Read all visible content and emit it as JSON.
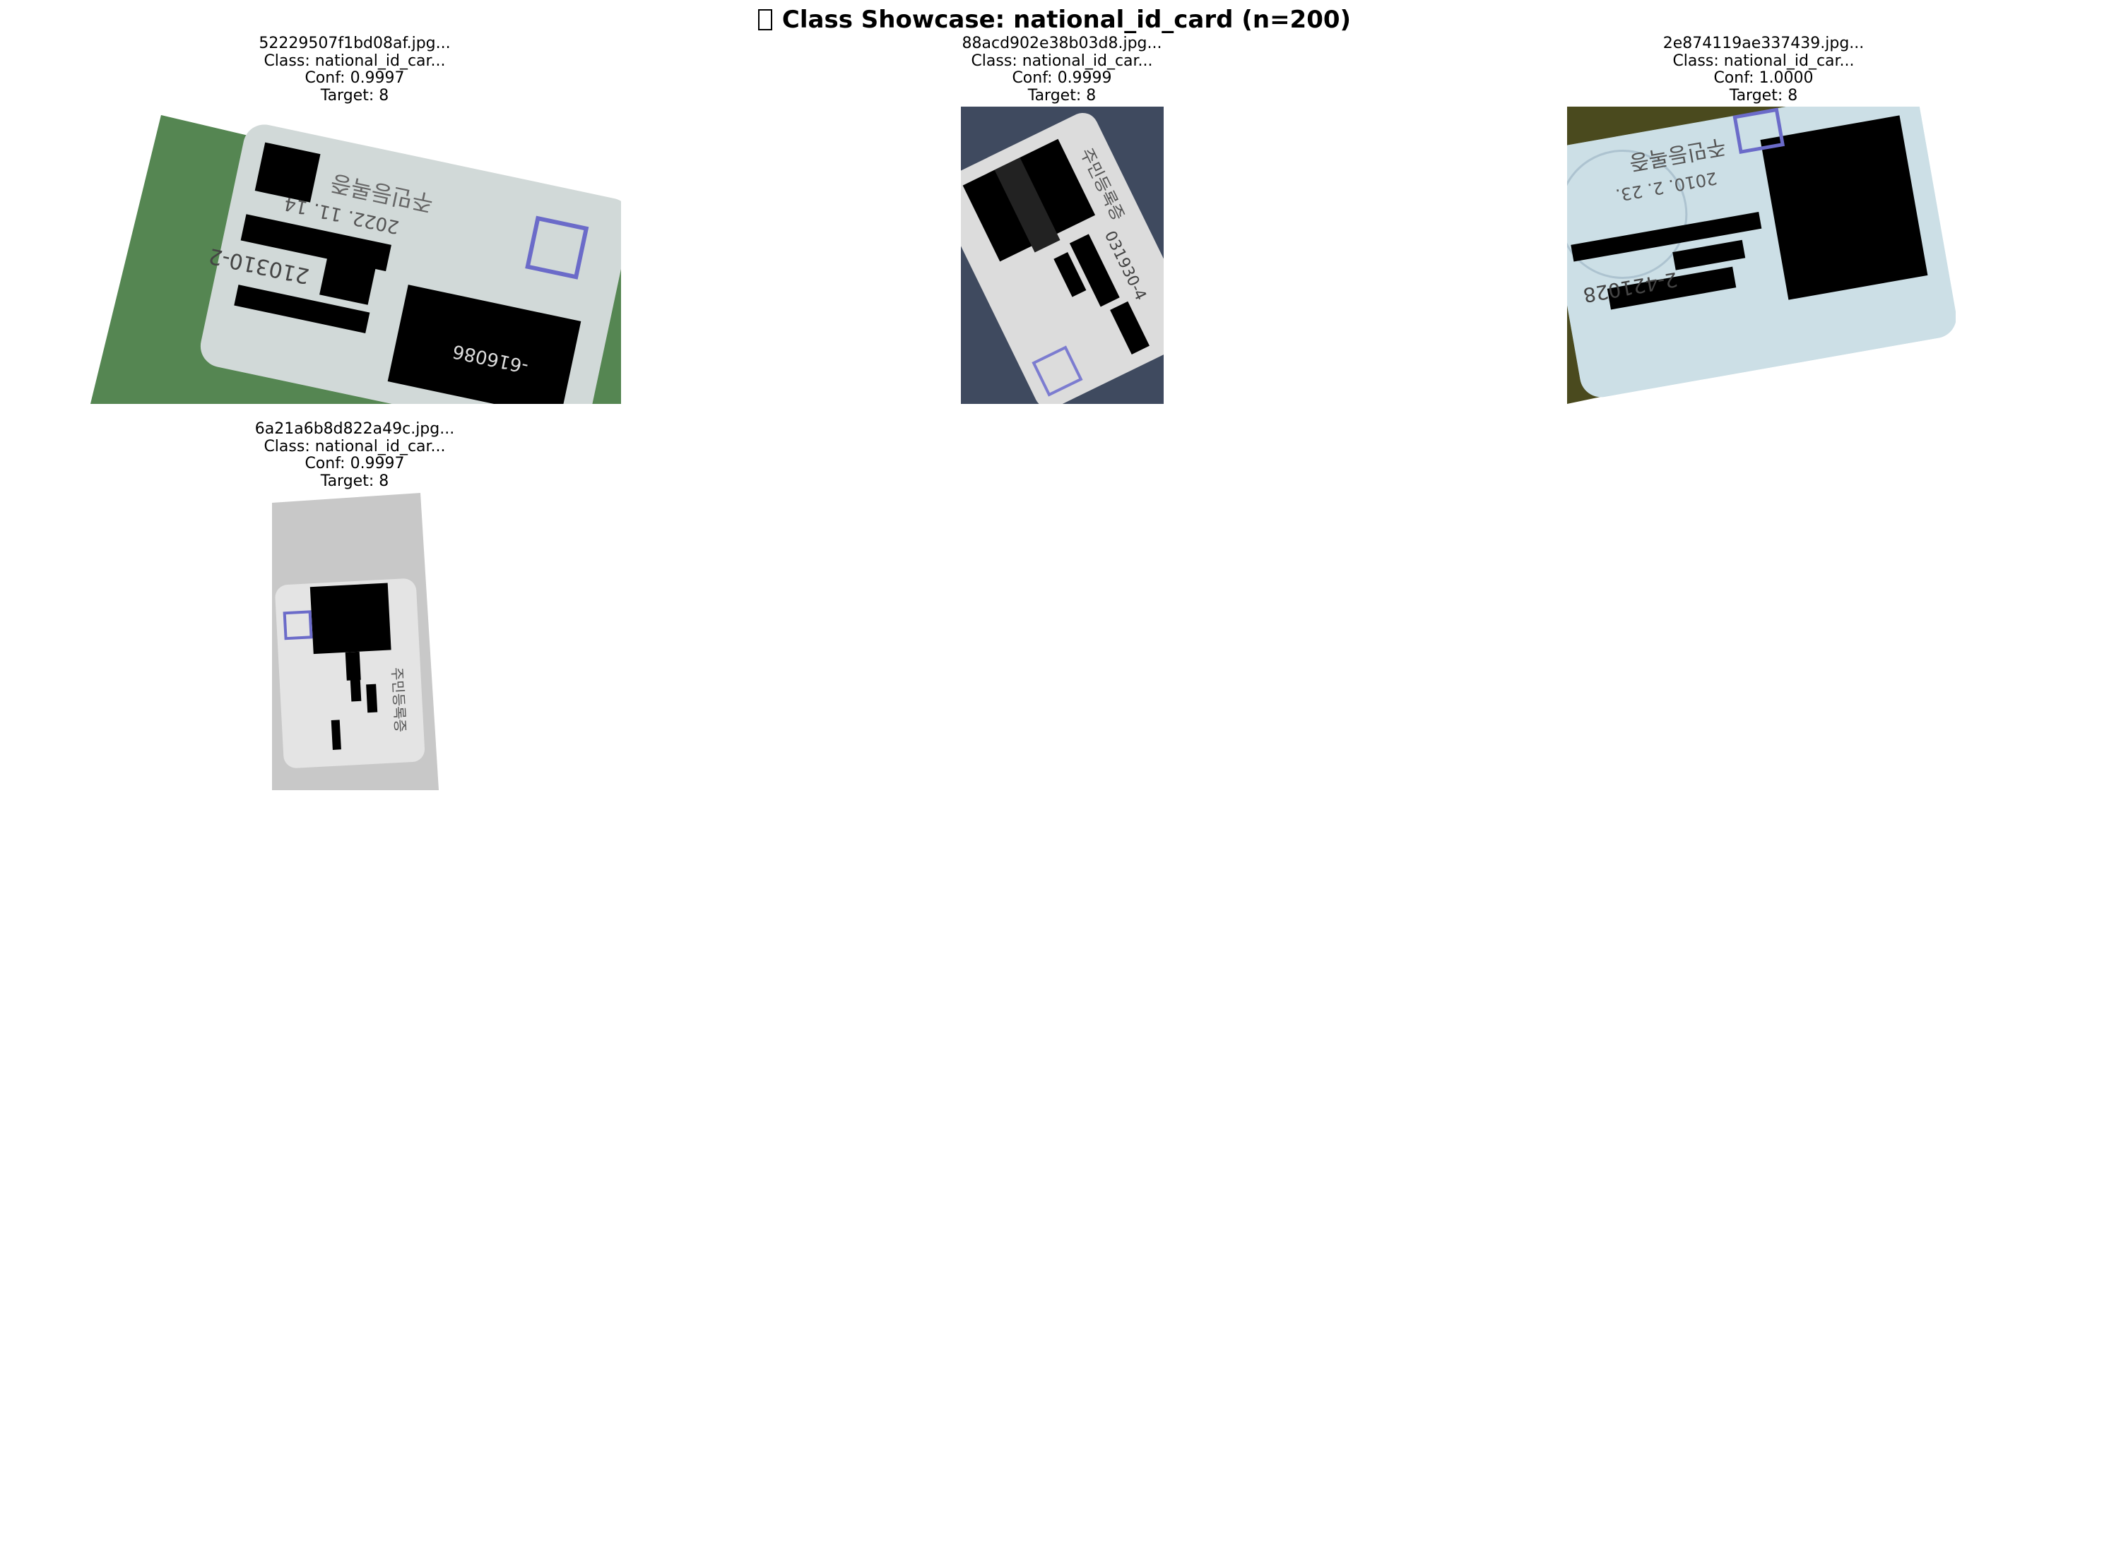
{
  "title": {
    "icon": "missing-glyph-box",
    "text": "Class Showcase: national_id_card (n=200)"
  },
  "samples": [
    {
      "filename": "52229507f1bd08af.jpg...",
      "class_line": "Class: national_id_car...",
      "conf_line": "Conf: 0.9997",
      "target_line": "Target: 8",
      "card_text": [
        "주민등록증",
        "2022. 11. 14",
        "210310-2",
        "-616086"
      ]
    },
    {
      "filename": "88acd902e38b03d8.jpg...",
      "class_line": "Class: national_id_car...",
      "conf_line": "Conf: 0.9999",
      "target_line": "Target: 8",
      "card_text": [
        "주민등록증",
        "031930-4"
      ]
    },
    {
      "filename": "2e874119ae337439.jpg...",
      "class_line": "Class: national_id_car...",
      "conf_line": "Conf: 1.0000",
      "target_line": "Target: 8",
      "card_text": [
        "주민등록증",
        "2010. 2. 23.",
        "2-421028"
      ]
    },
    {
      "filename": "6a21a6b8d822a49c.jpg...",
      "class_line": "Class: national_id_car...",
      "conf_line": "Conf: 0.9997",
      "target_line": "Target: 8",
      "card_text": [
        "주민등록증"
      ]
    }
  ],
  "colors": {
    "redaction": "#000000",
    "stamp": "#6b6bc9"
  }
}
